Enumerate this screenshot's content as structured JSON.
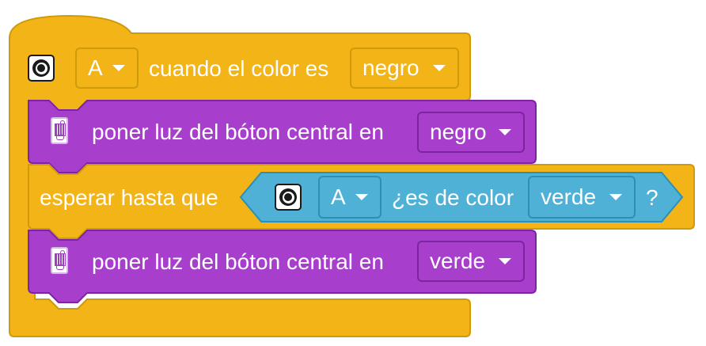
{
  "colors": {
    "event_yellow": "#f2b417",
    "light_purple": "#a73fcc",
    "sensor_blue": "#4fb1d6"
  },
  "hat_block": {
    "sensor_icon": "color-sensor-icon",
    "port": "A",
    "text": "cuando el color es",
    "color_value": "negro"
  },
  "set_light_1": {
    "hub_icon": "hub-icon",
    "text": "poner luz del bóton central en",
    "color_value": "negro"
  },
  "wait_block": {
    "text": "esperar hasta que",
    "condition": {
      "sensor_icon": "color-sensor-icon",
      "port": "A",
      "text": "¿es de color",
      "color_value": "verde",
      "suffix": "?"
    }
  },
  "set_light_2": {
    "hub_icon": "hub-icon",
    "text": "poner luz del bóton central en",
    "color_value": "verde"
  }
}
